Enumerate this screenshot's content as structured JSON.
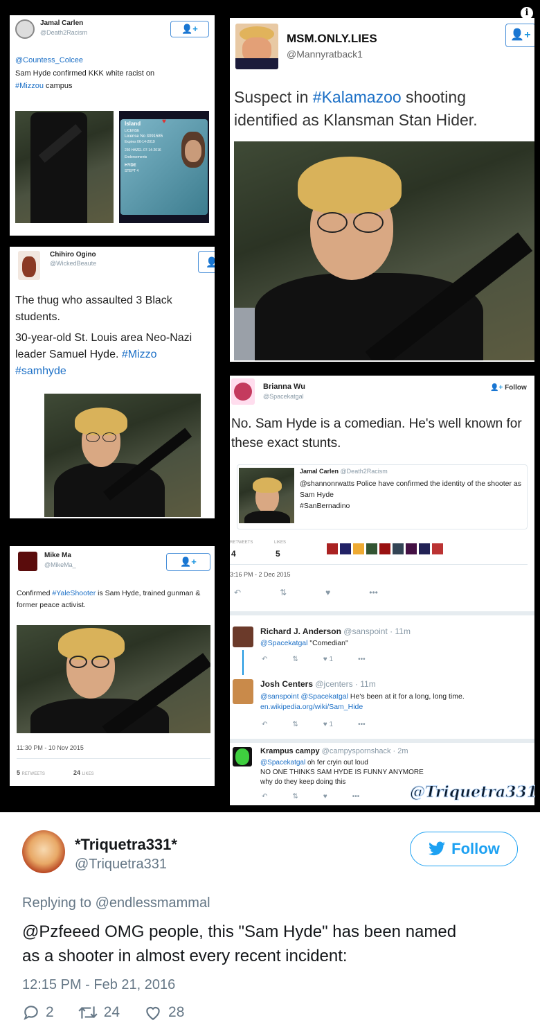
{
  "collage": {
    "tweet1": {
      "name": "Jamal Carlen",
      "handle": "@Death2Racism",
      "reply_to": "@Countess_Colcee",
      "text": "Sam Hyde confirmed KKK white racist on",
      "hashtag": "#Mizzou",
      "text_end": "campus",
      "id_card": {
        "title": "Island",
        "line1": "LICENSE",
        "license_no": "License No 3091585",
        "expires": "Expires 06-14-2019",
        "line3": "230 HAZEL 07-14-2016",
        "line4": "Endorsements",
        "name_line": "HYDE",
        "line6": "STEPT 4"
      }
    },
    "tweet2": {
      "name": "MSM.ONLY.LIES",
      "handle": "@Mannyratback1",
      "text_before": "Suspect in",
      "hashtag": "#Kalamazoo",
      "text_after": "shooting identified as Klansman Stan Hider."
    },
    "tweet3": {
      "name": "Chihiro Ogino",
      "handle": "@WickedBeaute",
      "line1": "The thug who assaulted 3 Black students.",
      "line2": "30-year-old St. Louis area Neo-Nazi leader Samuel Hyde.",
      "hashtag1": "#Mizzo",
      "hashtag2": "#samhyde"
    },
    "tweet4": {
      "name": "Mike Ma",
      "handle": "@MikeMa_",
      "text_before": "Confirmed",
      "hashtag": "#YaleShooter",
      "text_after": "is Sam Hyde, trained gunman & former peace activist.",
      "timestamp": "11:30 PM - 10 Nov 2015",
      "retweets": "5",
      "retweets_label": "RETWEETS",
      "likes": "24",
      "likes_label": "LIKES"
    },
    "tweet5": {
      "name": "Brianna Wu",
      "handle": "@Spacekatgal",
      "follow_label": "Follow",
      "text": "No. Sam Hyde is a comedian. He's well known for these exact stunts.",
      "quoted": {
        "name": "Jamal Carlen",
        "handle": "@Death2Racism",
        "mention": "@shannonrwatts",
        "text": "Police have confirmed the identity of the shooter as Sam Hyde",
        "hashtag": "#SanBernadino"
      },
      "retweets_label": "RETWEETS",
      "retweets": "4",
      "likes_label": "LIKES",
      "likes": "5",
      "timestamp": "3:16 PM - 2 Dec 2015",
      "replies": [
        {
          "name": "Richard J. Anderson",
          "handle": "@sanspoint",
          "time": "· 11m",
          "mention": "@Spacekatgal",
          "text": "\"Comedian\"",
          "likes": "1"
        },
        {
          "name": "Josh Centers",
          "handle": "@jcenters",
          "time": "· 11m",
          "mention": "@sanspoint @Spacekatgal",
          "text": "He's been at it for a long, long time.",
          "link": "en.wikipedia.org/wiki/Sam_Hide",
          "likes": "1"
        },
        {
          "name": "Krampus campy",
          "handle": "@campyspornshack",
          "time": "· 2m",
          "mention": "@Spacekatgal",
          "text": "oh fer cryin out loud",
          "line2": "NO ONE THINKS SAM HYDE IS FUNNY ANYMORE",
          "line3": "why do they keep doing this"
        }
      ]
    },
    "watermark": "@Triquetra331"
  },
  "tweet": {
    "display_name": "*Triquetra331*",
    "handle": "@Triquetra331",
    "follow_label": "Follow",
    "replying_to": "Replying to @endlessmammal",
    "text_line1": "@Pzfeeed OMG people, this \"Sam Hyde\" has been named",
    "text_line2": "as a shooter in almost every recent incident:",
    "timestamp": "12:15 PM - Feb 21, 2016",
    "replies": "2",
    "retweets": "24",
    "likes": "28"
  },
  "colors": {
    "twitter_blue": "#1da1f2",
    "link_blue": "#1b6fc6",
    "gray": "#8899a6"
  }
}
